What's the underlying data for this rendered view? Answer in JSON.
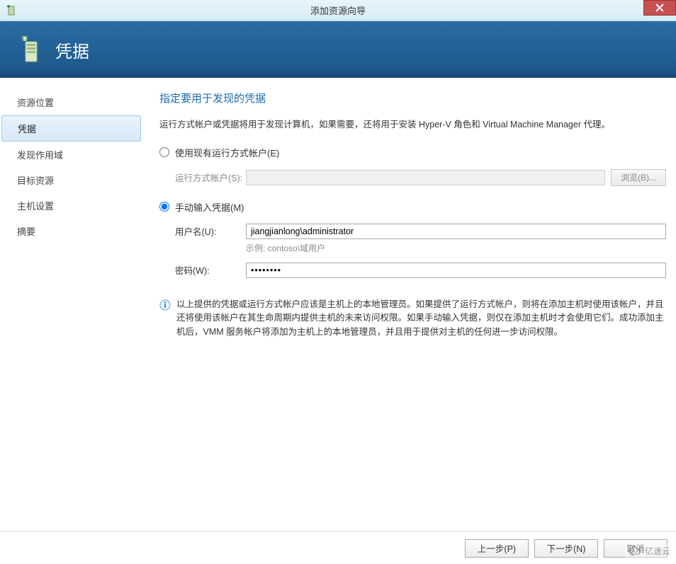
{
  "window": {
    "title": "添加资源向导"
  },
  "header": {
    "title": "凭据"
  },
  "sidebar": {
    "items": [
      {
        "label": "资源位置",
        "active": false
      },
      {
        "label": "凭据",
        "active": true
      },
      {
        "label": "发现作用域",
        "active": false
      },
      {
        "label": "目标资源",
        "active": false
      },
      {
        "label": "主机设置",
        "active": false
      },
      {
        "label": "摘要",
        "active": false
      }
    ]
  },
  "content": {
    "title": "指定要用于发现的凭据",
    "description": "运行方式帐户或凭据将用于发现计算机，如果需要，还将用于安装 Hyper-V 角色和 Virtual Machine Manager 代理。",
    "option_existing": {
      "label": "使用现有运行方式帐户(E)",
      "account_label": "运行方式帐户(S):",
      "browse_button": "浏览(B)..."
    },
    "option_manual": {
      "label": "手动输入凭据(M)",
      "username_label": "用户名(U):",
      "username_value": "jiangjianlong\\administrator",
      "username_hint": "示例: contoso\\域用户",
      "password_label": "密码(W):",
      "password_value": "••••••••"
    },
    "info_text": "以上提供的凭据或运行方式帐户应该是主机上的本地管理员。如果提供了运行方式帐户，则将在添加主机时使用该帐户，并且还将使用该帐户在其生命周期内提供主机的未来访问权限。如果手动输入凭据，则仅在添加主机时才会使用它们。成功添加主机后，VMM 服务帐户将添加为主机上的本地管理员，并且用于提供对主机的任何进一步访问权限。"
  },
  "footer": {
    "prev": "上一步(P)",
    "next": "下一步(N)",
    "cancel": "取消"
  },
  "watermark": {
    "text": "亿速云"
  }
}
